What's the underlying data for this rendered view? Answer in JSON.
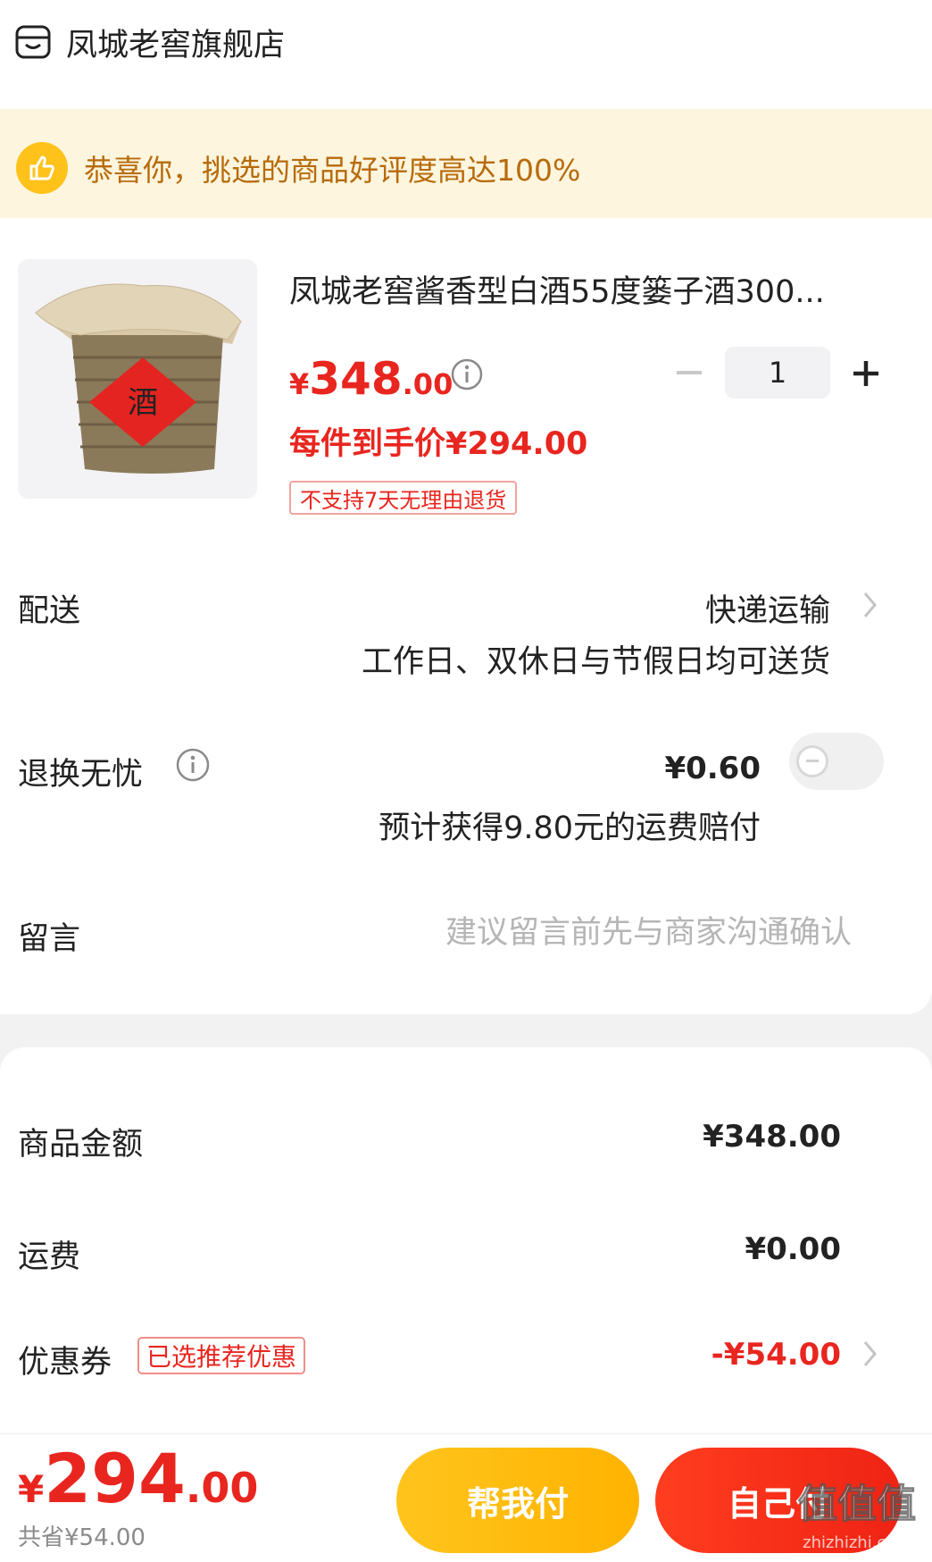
{
  "store": {
    "name": "凤城老窖旗舰店",
    "icon": "shop-icon"
  },
  "banner": {
    "text": "恭喜你，挑选的商品好评度高达100%",
    "icon": "thumbs-up-icon"
  },
  "product": {
    "title": "凤城老窖酱香型白酒55度篓子酒300...",
    "image_label": "酒",
    "price_symbol": "¥",
    "price_int": "348",
    "price_dec": ".00",
    "quantity": "1",
    "unit_price": "每件到手价¥294.00",
    "tag": "不支持7天无理由退货"
  },
  "delivery": {
    "label": "配送",
    "value": "快递运输",
    "note": "工作日、双休日与节假日均可送货"
  },
  "return_worry": {
    "label": "退换无忧",
    "price": "¥0.60",
    "note": "预计获得9.80元的运费赔付",
    "toggle_on": false
  },
  "message": {
    "label": "留言",
    "placeholder": "建议留言前先与商家沟通确认"
  },
  "summary": {
    "goods_label": "商品金额",
    "goods_value": "¥348.00",
    "shipping_label": "运费",
    "shipping_value": "¥0.00",
    "coupon_label": "优惠券",
    "coupon_tag": "已选推荐优惠",
    "coupon_value": "-¥54.00"
  },
  "bottom": {
    "total_symbol": "¥",
    "total_int": "294",
    "total_dec": ".00",
    "saved": "共省¥54.00",
    "help_pay": "帮我付",
    "self_pay": "自己付",
    "watermark": "值值值",
    "watermark_url": "zhizhizhi.com"
  },
  "colors": {
    "accent_red": "#e8261f",
    "yellow": "#ffc21a",
    "banner_text": "#b76b0c"
  }
}
